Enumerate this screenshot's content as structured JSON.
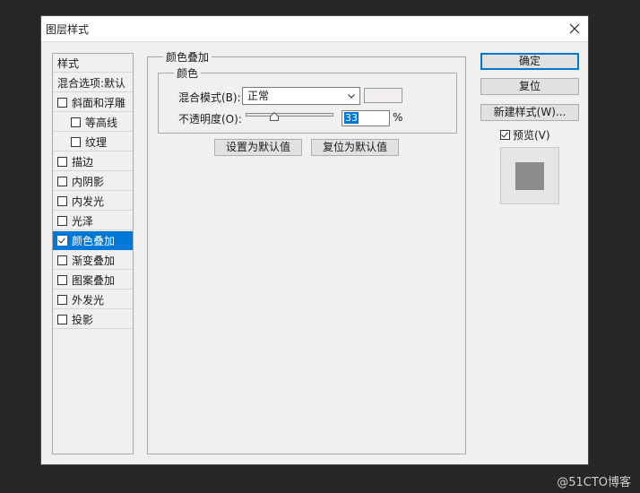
{
  "dialog": {
    "title": "图层样式"
  },
  "left_panel": {
    "header": "样式",
    "blend_options": "混合选项:默认",
    "items": [
      {
        "label": "斜面和浮雕",
        "checked": false
      },
      {
        "label": "等高线",
        "checked": false
      },
      {
        "label": "纹理",
        "checked": false
      },
      {
        "label": "描边",
        "checked": false
      },
      {
        "label": "内阴影",
        "checked": false
      },
      {
        "label": "内发光",
        "checked": false
      },
      {
        "label": "光泽",
        "checked": false
      },
      {
        "label": "颜色叠加",
        "checked": true,
        "selected": true
      },
      {
        "label": "渐变叠加",
        "checked": false
      },
      {
        "label": "图案叠加",
        "checked": false
      },
      {
        "label": "外发光",
        "checked": false
      },
      {
        "label": "投影",
        "checked": false
      }
    ]
  },
  "color_overlay": {
    "group_title": "颜色叠加",
    "sub_group_title": "颜色",
    "blend_mode_label": "混合模式(B):",
    "blend_mode_value": "正常",
    "opacity_label": "不透明度(O):",
    "opacity_value": "33",
    "opacity_unit": "%",
    "opacity_percent": 33,
    "overlay_color": "#f3eeee",
    "set_default_label": "设置为默认值",
    "reset_default_label": "复位为默认值"
  },
  "actions": {
    "ok_label": "确定",
    "reset_label": "复位",
    "new_style_label": "新建样式(W)...",
    "preview_label": "预览(V)",
    "preview_checked": true
  },
  "watermark": "@51CTO博客"
}
